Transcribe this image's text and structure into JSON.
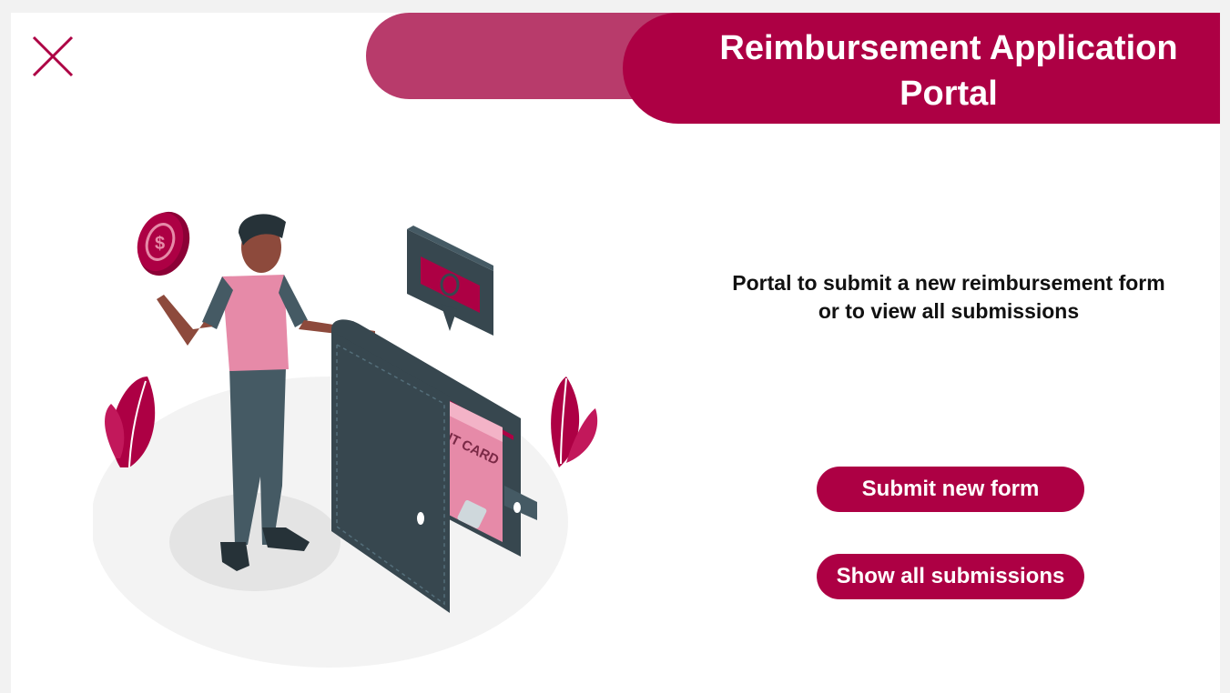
{
  "header": {
    "title_line1": "Reimbursement Application",
    "title_line2": "Portal"
  },
  "close_icon": "close-icon",
  "description": {
    "line1": "Portal to submit a new reimbursement form",
    "line2": "or to view all submissions"
  },
  "buttons": {
    "submit_label": "Submit new form",
    "show_label": "Show all submissions"
  },
  "illustration": {
    "card_text": "CREDIT CARD",
    "coin_symbol": "$"
  },
  "colors": {
    "accent": "#ad0044",
    "accent_light": "#b83b6b",
    "dark": "#37474f",
    "pink": "#e68aa8"
  }
}
